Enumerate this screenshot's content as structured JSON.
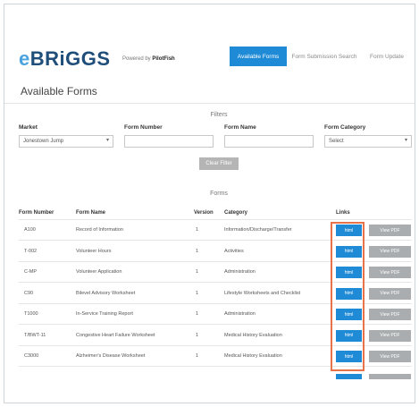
{
  "header": {
    "logo_e": "e",
    "logo_rest": "BRiGGS",
    "powered_prefix": "Powered by",
    "powered_brand": "PilotFish",
    "nav": [
      "Available Forms",
      "Form Submission Search",
      "Form Update"
    ]
  },
  "page_title": "Available Forms",
  "filters": {
    "heading": "Filters",
    "labels": {
      "market": "Market",
      "form_number": "Form Number",
      "form_name": "Form Name",
      "form_category": "Form Category"
    },
    "values": {
      "market": "Jonestown Jump",
      "form_number": "",
      "form_name": "",
      "form_category": "Select"
    },
    "clear_button": "Clear Filter"
  },
  "forms": {
    "heading": "Forms",
    "columns": [
      "Form Number",
      "Form Name",
      "Version",
      "Category",
      "Links"
    ],
    "rows": [
      {
        "number": "A100",
        "name": "Record of Information",
        "version": "1",
        "category": "Information/Discharge/Transfer"
      },
      {
        "number": "T-002",
        "name": "Volunteer Hours",
        "version": "1",
        "category": "Activities"
      },
      {
        "number": "C-MP",
        "name": "Volunteer Application",
        "version": "1",
        "category": "Administration"
      },
      {
        "number": "C90",
        "name": "Bilevel Advisory Worksheet",
        "version": "1",
        "category": "Lifestyle Worksheets and Checklist"
      },
      {
        "number": "T1000",
        "name": "In-Service Training Report",
        "version": "1",
        "category": "Administration"
      },
      {
        "number": "T/BWT-11",
        "name": "Congestive Heart Failure Worksheet",
        "version": "1",
        "category": "Medical History Evaluation"
      },
      {
        "number": "C3000",
        "name": "Alzheimer's Disease Worksheet",
        "version": "1",
        "category": "Medical History Evaluation"
      }
    ],
    "html_label": "html",
    "pdf_label": "View PDF"
  },
  "colors": {
    "accent": "#1f8bd6",
    "highlight": "#e8734a",
    "logo_e": "#4aa3df",
    "logo_text": "#1e4e79"
  }
}
